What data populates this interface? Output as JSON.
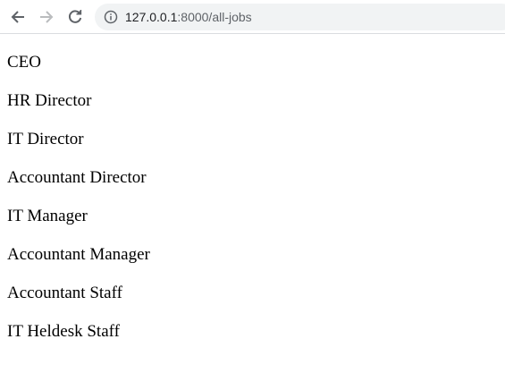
{
  "browser": {
    "url_host": "127.0.0.1",
    "url_path": ":8000/all-jobs"
  },
  "jobs": [
    "CEO",
    "HR Director",
    "IT Director",
    "Accountant Director",
    "IT Manager",
    "Accountant Manager",
    "Accountant Staff",
    "IT Heldesk Staff"
  ]
}
